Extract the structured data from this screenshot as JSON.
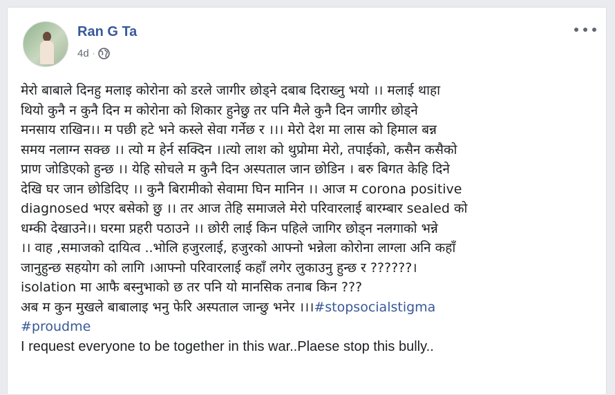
{
  "post": {
    "author": "Ran G Ta",
    "time": "4d",
    "separator": "·",
    "privacy_icon": "globe-icon",
    "more_icon": "more-options-icon",
    "lines": [
      "मेरो बाबाले दिनहु मलाइ कोरोना को डरले जागीर छोड्ने दबाब दिराख्नु भयो ।। मलाई थाहा",
      "थियो कुनै न कुनै दिन म कोरोना को शिकार हुनेछु तर पनि मैले कुनै दिन जागीर छोड्ने",
      "मनसाय राखिन।। म पछी हटे भने कस्ले सेवा गर्नेछ र ।।। मेरो देश मा लास को हिमाल बन्न",
      "समय नलाग्न सक्छ ।। त्यो म हेर्न सक्दिन ।।त्यो लाश को थुप्रोमा मेरो, तपाईको, कसैन कसैको",
      "प्राण जोडिएको हुन्छ ।। येहि सोचले म कुनै दिन अस्पताल जान छोडिन । बरु बिगत केहि दिने",
      "देखि घर जान छोडिदिए ।। कुनै बिरामीको सेवामा घिन मानिन ।। आज म corona positive",
      "diagnosed भएर बसेको छु ।। तर आज तेहि समाजले मेरो परिवारलाई बारम्बार sealed को",
      "धम्की देखाउने।। घरमा प्रहरी पठाउने ।। छोरी लाई किन पहिले जागिर छोड्न नलगाको भन्ने",
      "।। वाह ,समाजको दायित्व ..भोलि हजुरलाई, हजुरको आफ्नो भन्नेला कोरोना लाग्ला अनि कहाँ",
      "जानुहुन्छ सहयोग को लागि ।आफ्नो परिवारलाई कहाँ लगेर लुकाउनु हुन्छ र ??????।",
      "isolation मा आफै बस्नुभाको छ तर पनि यो मानसिक तनाब किन ???"
    ],
    "last_line_text": "अब म कुन मुखले बाबालाइ भनु फेरि अस्पताल जान्छु भनेर ।।।",
    "hashtag_1": "#stopsocialstigma",
    "hashtag_2": "#proudme",
    "closing_line": "I request everyone to be together in this war..Plaese stop this bully..",
    "colors": {
      "link": "#385898",
      "text": "#1c1e21",
      "meta": "#616770",
      "background": "#e9ebee"
    }
  }
}
